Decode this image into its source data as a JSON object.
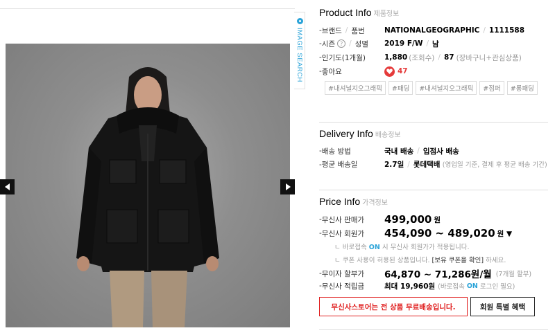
{
  "gallery": {
    "image_search_label": "IMAGE SEARCH",
    "photo_alt": "model wearing black parka"
  },
  "product_info": {
    "title": "Product Info",
    "subtitle": "제품정보",
    "brand_label": "브랜드",
    "model_no_label": "품번",
    "brand_value": "NATIONALGEOGRAPHIC",
    "model_no_value": "1111588",
    "season_label": "시즌",
    "gender_label": "성별",
    "season_value": "2019 F/W",
    "gender_value": "남",
    "popularity_label": "인기도(1개월)",
    "views_value": "1,880",
    "views_suffix": "(조회수)",
    "carts_value": "87",
    "carts_suffix": "(장바구니+관심상품)",
    "likes_label": "좋아요",
    "likes_value": "47",
    "tags": [
      "#내셔널지오그래픽",
      "#패딩",
      "#내셔널지오그래픽",
      "#점퍼",
      "#롱패딩"
    ]
  },
  "delivery_info": {
    "title": "Delivery Info",
    "subtitle": "배송정보",
    "method_label": "배송 방법",
    "method_domestic": "국내 배송",
    "method_store": "입점사 배송",
    "avg_label": "평균 배송일",
    "avg_days": "2.7일",
    "courier": "롯데택배",
    "avg_note": "(영업일 기준, 결제 후 평균 배송 기간)"
  },
  "price_info": {
    "title": "Price Info",
    "subtitle": "가격정보",
    "sale_label": "무신사 판매가",
    "sale_price": "499,000",
    "won": "원",
    "member_label": "무신사 회원가",
    "member_price": "454,090 ~ 489,020",
    "member_won": "원 ▼",
    "note1_pre": "바로접속",
    "note1_on": "ON",
    "note1_post": "시 무신사 회원가가 적용됩니다.",
    "note2_pre": "쿠폰 사용이 허용된 상품입니다.",
    "note2_box": "[보유 쿠폰을 확인]",
    "note2_post": "하세요.",
    "installment_label": "무이자 할부가",
    "installment_value": "64,870 ~ 71,286원/월",
    "installment_note": "(7개월 할부)",
    "points_label": "무신사 적립금",
    "points_value": "최대 19,960원",
    "points_note_pre": "(바로접속",
    "points_note_on": "ON",
    "points_note_post": "로그인 필요)"
  },
  "actions": {
    "free_shipping_button": "무신사스토어는 전 상품 무료배송입니다.",
    "member_benefit_button": "회원 특별 혜택"
  },
  "colors": {
    "accent_blue": "#2aa3d8",
    "alert_red": "#e02020",
    "heart_red": "#e53b3b"
  }
}
